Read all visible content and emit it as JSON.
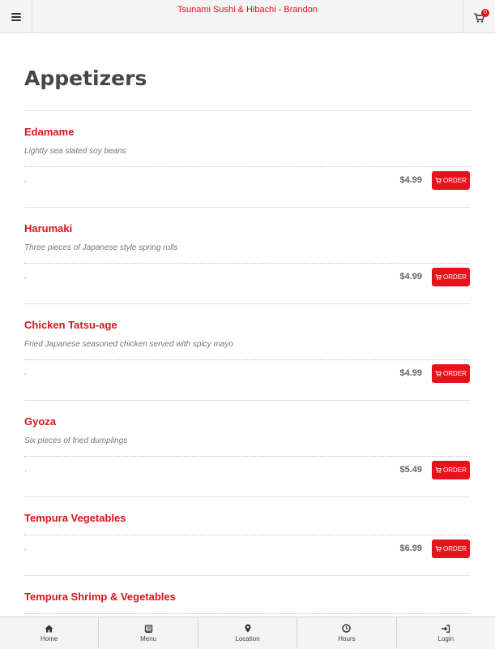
{
  "header": {
    "brand": "Tsunami Sushi & Hibachi - Brandon",
    "cart_count": "0"
  },
  "section": {
    "title": "Appetizers"
  },
  "items": [
    {
      "name": "Edamame",
      "description": "Lightly sea slated soy beans",
      "dot": ".",
      "price": "$4.99",
      "order_label": "ORDER"
    },
    {
      "name": "Harumaki",
      "description": "Three pieces of Japanese style spring rolls",
      "dot": ".",
      "price": "$4.99",
      "order_label": "ORDER"
    },
    {
      "name": "Chicken Tatsu-age",
      "description": "Fried Japanese seasoned chicken served with spicy mayo",
      "dot": ".",
      "price": "$4.99",
      "order_label": "ORDER"
    },
    {
      "name": "Gyoza",
      "description": "Six pieces of fried dumplings",
      "dot": ".",
      "price": "$5.49",
      "order_label": "ORDER"
    },
    {
      "name": "Tempura Vegetables",
      "description": "",
      "dot": ".",
      "price": "$6.99",
      "order_label": "ORDER"
    },
    {
      "name": "Tempura Shrimp & Vegetables",
      "description": "",
      "dot": "",
      "price": "",
      "order_label": ""
    }
  ],
  "bottom_nav": [
    {
      "label": "Home",
      "icon": "home-icon"
    },
    {
      "label": "Menu",
      "icon": "book-icon"
    },
    {
      "label": "Location",
      "icon": "map-marker-icon"
    },
    {
      "label": "Hours",
      "icon": "clock-icon"
    },
    {
      "label": "Login",
      "icon": "login-icon"
    }
  ],
  "colors": {
    "accent": "#d9131b",
    "order_button": "#e8121c",
    "title": "#464646"
  }
}
